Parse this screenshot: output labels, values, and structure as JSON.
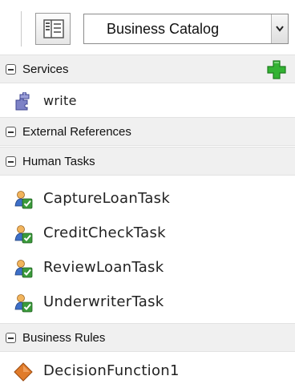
{
  "toolbar": {
    "view_button_icon": "tree-view-icon",
    "catalog_select": {
      "value": "Business Catalog"
    }
  },
  "sections": {
    "services": {
      "label": "Services",
      "add_icon": "add-icon"
    },
    "external_references": {
      "label": "External References"
    },
    "human_tasks": {
      "label": "Human Tasks"
    },
    "business_rules": {
      "label": "Business Rules"
    }
  },
  "items": {
    "write": {
      "label": "write",
      "icon": "puzzle-service-icon"
    },
    "capture_loan_task": {
      "label": "CaptureLoanTask",
      "icon": "human-task-icon"
    },
    "credit_check_task": {
      "label": "CreditCheckTask",
      "icon": "human-task-icon"
    },
    "review_loan_task": {
      "label": "ReviewLoanTask",
      "icon": "human-task-icon"
    },
    "underwriter_task": {
      "label": "UnderwriterTask",
      "icon": "human-task-icon"
    },
    "decision_function1": {
      "label": "DecisionFunction1",
      "icon": "business-rule-icon"
    }
  },
  "colors": {
    "section_bg": "#f0f0f0",
    "add_green": "#2eaa2e",
    "rule_orange": "#e07b2a",
    "task_check_green": "#3a9a3a"
  }
}
